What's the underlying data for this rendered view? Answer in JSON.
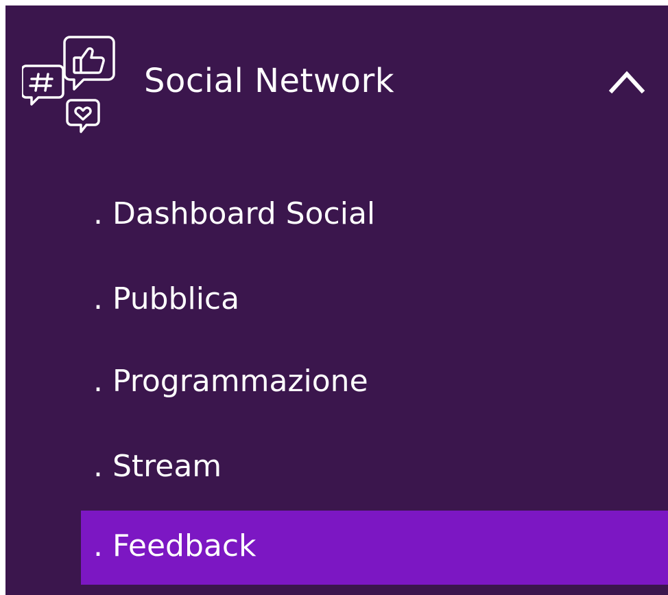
{
  "menu": {
    "section": {
      "title": "Social Network",
      "icon": "social-network-icon",
      "expanded": true,
      "chevron_icon": "chevron-up-icon"
    },
    "items": [
      {
        "label": ". Dashboard Social",
        "active": false
      },
      {
        "label": ". Pubblica",
        "active": false
      },
      {
        "label": ". Programmazione",
        "active": false
      },
      {
        "label": ". Stream",
        "active": false
      },
      {
        "label": ". Feedback",
        "active": true
      }
    ]
  },
  "colors": {
    "background": "#3b164d",
    "active_item": "#7c17c3",
    "text": "#ffffff"
  }
}
